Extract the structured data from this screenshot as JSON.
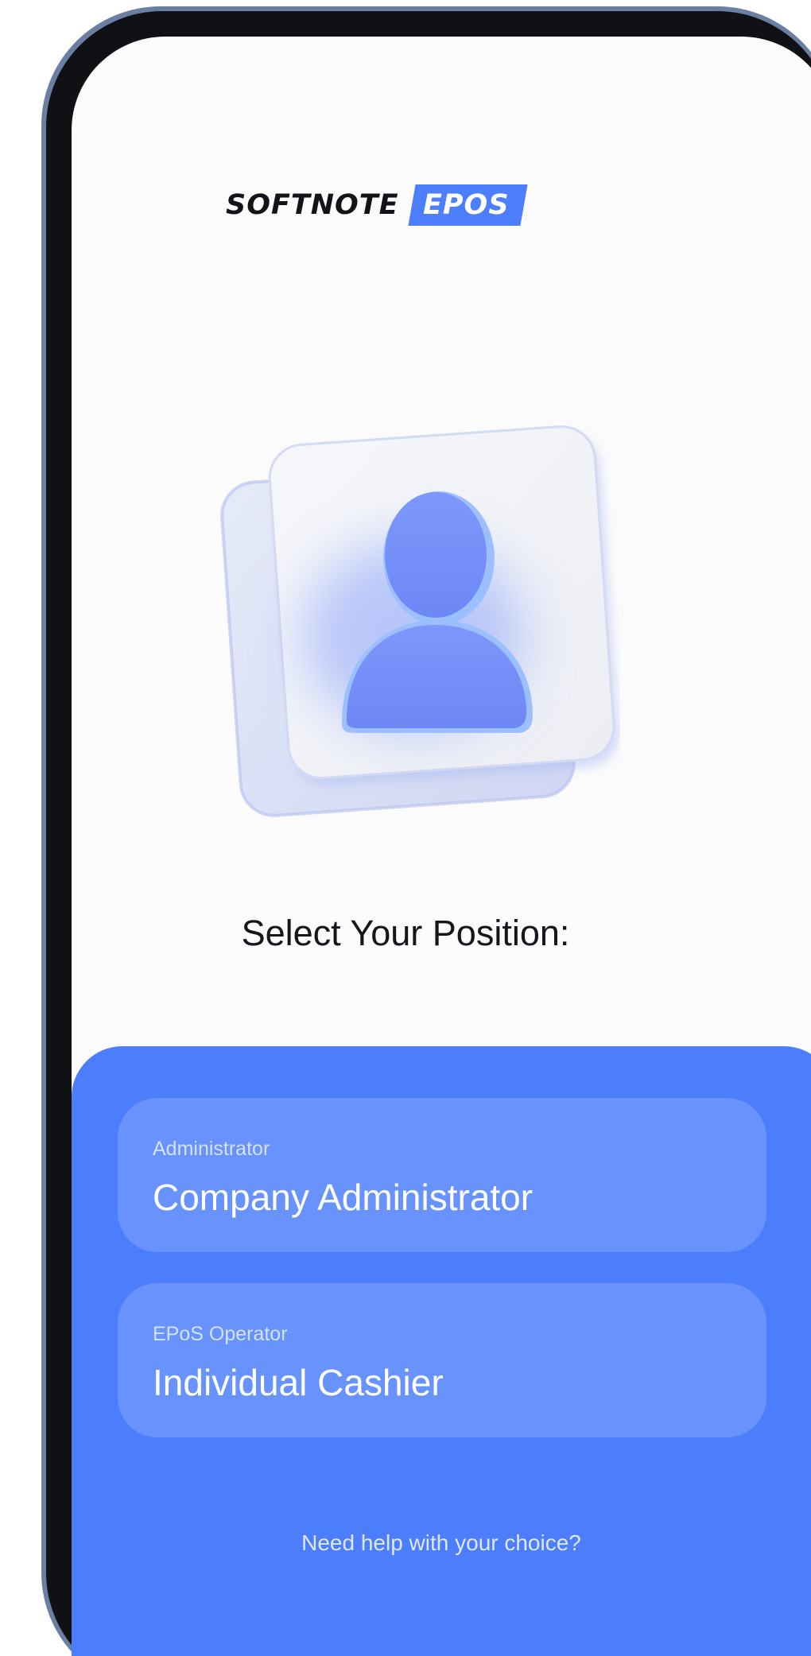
{
  "logo": {
    "word": "SOFTNOTE",
    "badge": "EPOS",
    "badge_color": "#4d7efb"
  },
  "illustration": {
    "icon": "user-profile-icon"
  },
  "heading": "Select Your Position:",
  "options": [
    {
      "role_label": "Administrator",
      "title": "Company Administrator"
    },
    {
      "role_label": "EPoS Operator",
      "title": "Individual Cashier"
    }
  ],
  "help_link": "Need help with your choice?",
  "colors": {
    "accent": "#4c7dfa",
    "option_card": "#6893fd",
    "frame": "#0f1114",
    "frame_edge": "#6b7fa3"
  }
}
